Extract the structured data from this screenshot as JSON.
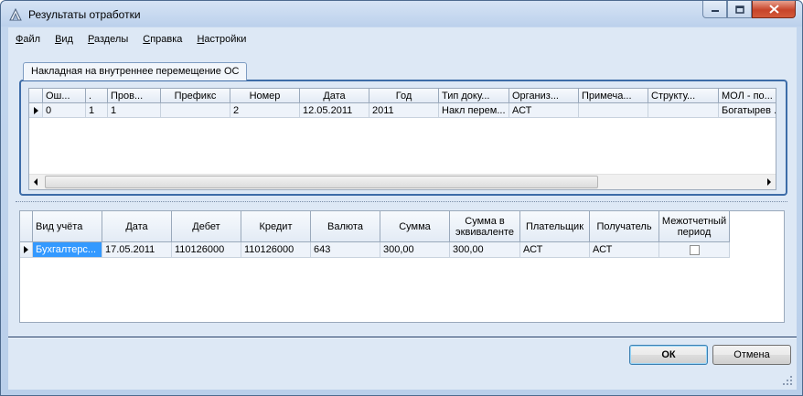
{
  "window": {
    "title": "Результаты отработки",
    "controls": {
      "minimize": "minimize-icon",
      "maximize": "maximize-icon",
      "close": "close-icon"
    }
  },
  "menu": [
    "Файл",
    "Вид",
    "Разделы",
    "Справка",
    "Настройки"
  ],
  "tab": {
    "label": "Накладная на внутреннее перемещение ОС"
  },
  "top_grid": {
    "columns": [
      "Ош...",
      ".",
      "Пров...",
      "Префикс",
      "Номер",
      "Дата",
      "Год",
      "Тип доку...",
      "Организ...",
      "Примеча...",
      "Структу...",
      "МОЛ - по..."
    ],
    "rows": [
      [
        "0",
        "1",
        "1",
        "",
        "2",
        "12.05.2011",
        "2011",
        "Накл перем...",
        "АСТ",
        "",
        "",
        "Богатырев ..."
      ]
    ]
  },
  "bottom_grid": {
    "columns": [
      "Вид учёта",
      "Дата",
      "Дебет",
      "Кредит",
      "Валюта",
      "Сумма",
      "Сумма в эквиваленте",
      "Плательщик",
      "Получатель",
      "Межотчетный период"
    ],
    "rows": [
      [
        "Бухгалтерс...",
        "17.05.2011",
        "110126000",
        "110126000",
        "643",
        "300,00",
        "300,00",
        "АСТ",
        "АСТ",
        ""
      ]
    ],
    "interperiod_checked": false
  },
  "buttons": {
    "ok": "ОК",
    "cancel": "Отмена"
  },
  "colors": {
    "selection": "#3399ff",
    "frame": "#3d6ca8",
    "client_bg": "#dde8f5"
  }
}
